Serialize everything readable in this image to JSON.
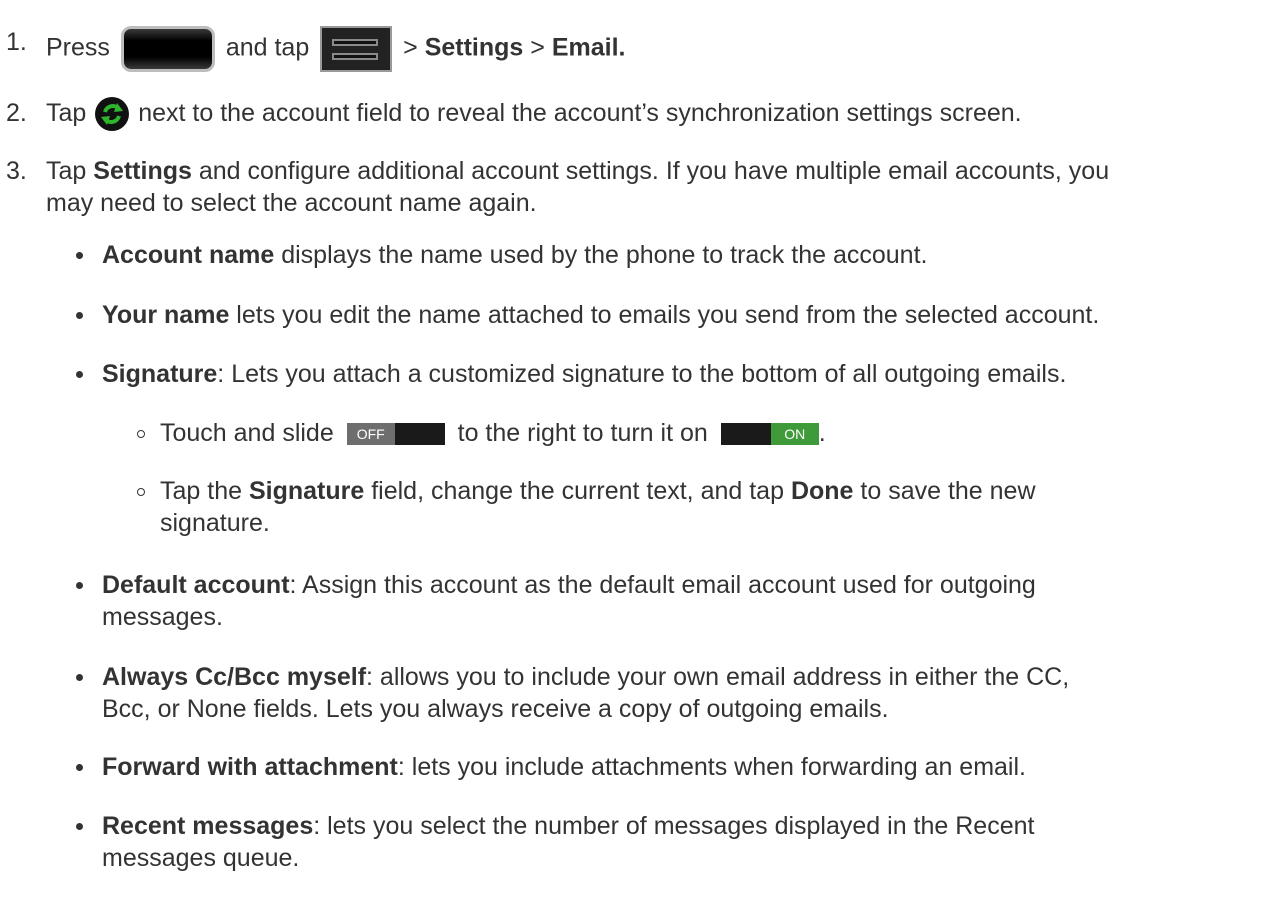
{
  "steps": [
    {
      "number": "1.",
      "press": "Press",
      "and_tap": "and tap",
      "sep1": ">",
      "settings": "Settings",
      "sep2": ">",
      "email": "Email."
    },
    {
      "number": "2.",
      "tap": "Tap",
      "rest": "next to the account field to reveal the account’s synchronization settings screen."
    },
    {
      "number": "3.",
      "tap": "Tap",
      "settings": "Settings",
      "rest_line1": "and configure additional account settings. If you have multiple email accounts, you",
      "line2": "may need to select the account name again."
    }
  ],
  "bullets": {
    "account_name": {
      "term": "Account name",
      "text": "displays the name used by the phone to track the account."
    },
    "your_name": {
      "term": "Your name",
      "text": "lets you edit the name attached to emails you send from the selected account."
    },
    "signature": {
      "term": "Signature",
      "text": ": Lets you attach a customized signature to the bottom of all outgoing emails."
    },
    "default_account": {
      "term": "Default account",
      "text": ": Assign this account as the default email account used for outgoing",
      "line2": "messages."
    },
    "always_cc": {
      "term": "Always Cc/Bcc myself",
      "text": ": allows you to include your own email address in either the CC,",
      "line2": "Bcc, or None fields. Lets you always receive a copy of outgoing emails."
    },
    "forward": {
      "term": "Forward with attachment",
      "text": ": lets you include attachments when forwarding an email."
    },
    "recent": {
      "term": "Recent messages",
      "text": ": lets you select the number of messages displayed in the Recent",
      "line2": "messages queue."
    }
  },
  "sub_bullets": {
    "toggle": {
      "text1": "Touch and slide",
      "text2": "to the right to turn it on",
      "end": ".",
      "off_label": "OFF",
      "on_label": "ON"
    },
    "signature_field": {
      "tap": "Tap the",
      "term": "Signature",
      "middle": "field, change the current text, and tap",
      "done": "Done",
      "rest": "to save the new",
      "line2": "signature."
    }
  },
  "icons": {
    "home": "home-key-icon",
    "menu": "menu-key-icon",
    "sync": "sync-icon",
    "sync_color": "#2db52b",
    "toggle_off_color": "#6e6e6e",
    "toggle_on_color": "#3f9b3a"
  }
}
